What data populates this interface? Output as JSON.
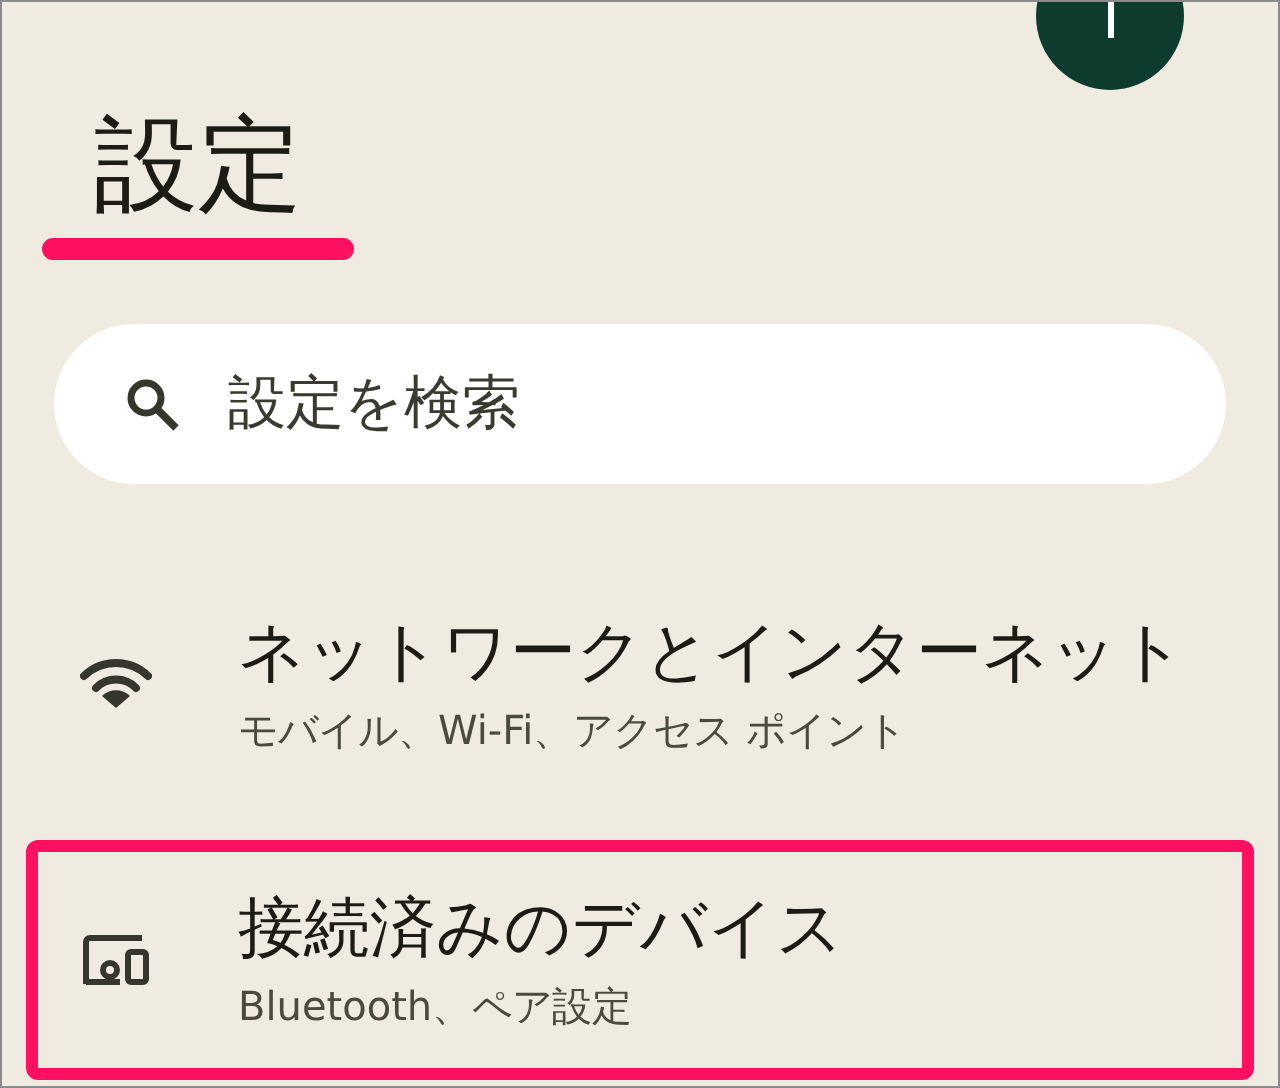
{
  "title": {
    "text": "設定",
    "underlined": true
  },
  "search": {
    "placeholder": "設定を検索"
  },
  "items": [
    {
      "kind": "network",
      "title": "ネットワークとインターネット",
      "subtitle": "モバイル、Wi-Fi、アクセス ポイント",
      "highlighted": false
    },
    {
      "kind": "devices",
      "title": "接続済みのデバイス",
      "subtitle": "Bluetooth、ペア設定",
      "highlighted": true
    }
  ]
}
